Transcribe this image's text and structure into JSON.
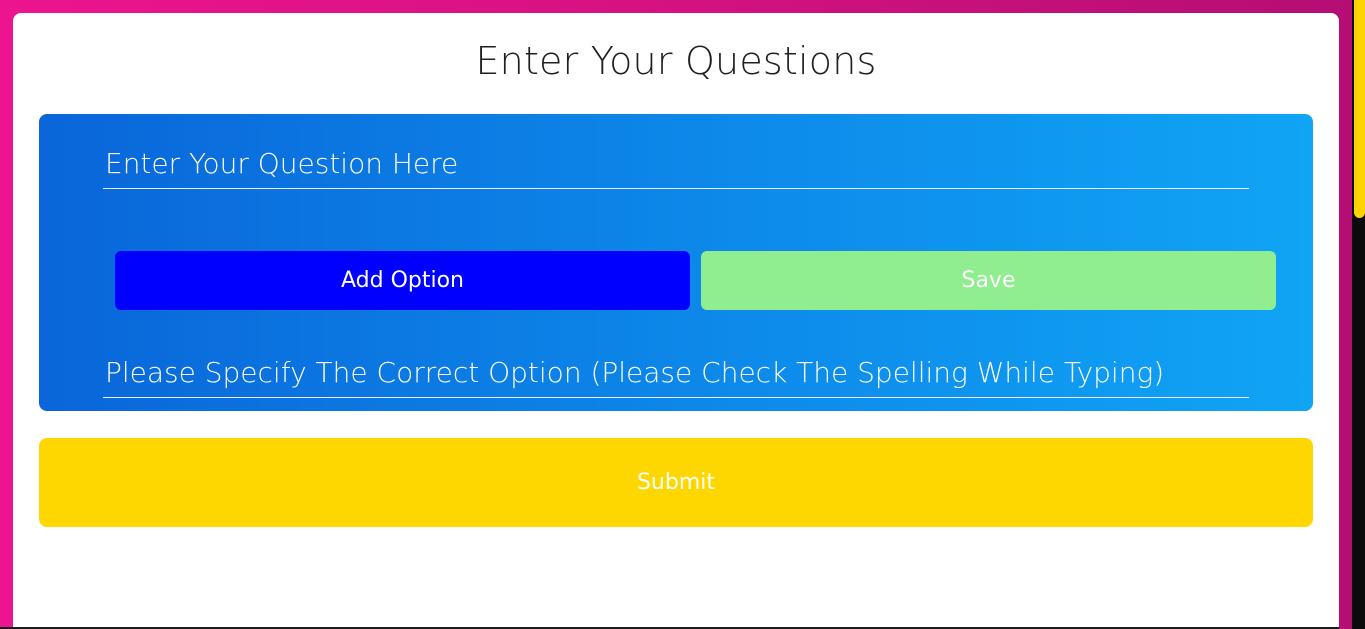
{
  "page": {
    "title": "Enter Your Questions"
  },
  "question_panel": {
    "question_placeholder": "Enter Your Question Here",
    "question_value": "",
    "correct_option_placeholder": "Please Specify The Correct Option (Please Check The Spelling While Typing)",
    "correct_option_value": ""
  },
  "buttons": {
    "add_option_label": "Add Option",
    "save_label": "Save",
    "submit_label": "Submit"
  },
  "colors": {
    "background_left": "#ec148f",
    "background_right": "#b40e73",
    "panel_gradient_start": "#0a66d9",
    "panel_gradient_end": "#10a4f5",
    "add_option": "#0000ff",
    "save": "#90ee90",
    "submit": "#ffd700",
    "scroll_thumb": "#ffd400"
  }
}
